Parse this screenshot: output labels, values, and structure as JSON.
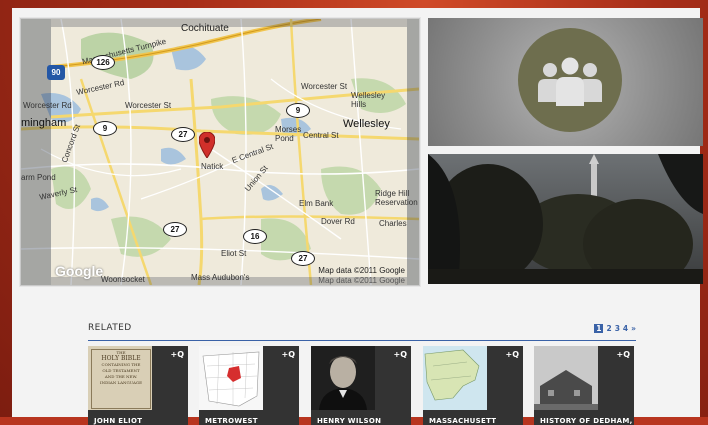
{
  "map": {
    "labels": {
      "cochituate": "Cochituate",
      "mass_turnpike": "Massachusetts Turnpike",
      "worcester_rd_top": "Worcester Rd",
      "worcester_st_right": "Worcester St",
      "wellesley_hills": "Wellesley Hills",
      "wellesley": "Wellesley",
      "framingham": "mingham",
      "worcester_rd_left": "Worcester Rd",
      "worcester_st_mid": "Worcester St",
      "morses_pond": "Morses Pond",
      "central_st": "Central St",
      "concord_st": "Concord St",
      "natick": "Natick",
      "e_central_st": "E Central St",
      "waverly_st": "Waverly St",
      "union_st": "Union St",
      "elm_bank": "Elm Bank",
      "ridge_hill": "Ridge Hill Reservation",
      "dover_rd": "Dover Rd",
      "charles": "Charles",
      "mass_audubon": "Mass Audubon's",
      "farm_pond": "arm Pond",
      "elliot_st": "Eliot St",
      "woonsocket": "Woonsocket"
    },
    "shields": [
      "126",
      "90",
      "9",
      "9",
      "27",
      "27",
      "16",
      "27"
    ],
    "credit": "Map data ©2011 Google",
    "credit2": "Map data ©2011 Google",
    "google": "Google"
  },
  "related": {
    "title": "RELATED",
    "pages": [
      "1",
      "2",
      "3",
      "4",
      "»"
    ],
    "cards": [
      {
        "label": "JOHN ELIOT",
        "badge": "+Q"
      },
      {
        "label": "METROWEST",
        "badge": "+Q"
      },
      {
        "label": "HENRY WILSON",
        "badge": "+Q"
      },
      {
        "label": "MASSACHUSETT",
        "badge": "+Q"
      },
      {
        "label": "HISTORY OF DEDHAM,",
        "badge": "+Q"
      }
    ],
    "bible_text": [
      "THE",
      "HOLY BIBLE",
      "CONTAINING THE",
      "OLD TESTAMENT",
      "AND THE NEW.",
      "INDIAN LANGUAGE"
    ]
  }
}
